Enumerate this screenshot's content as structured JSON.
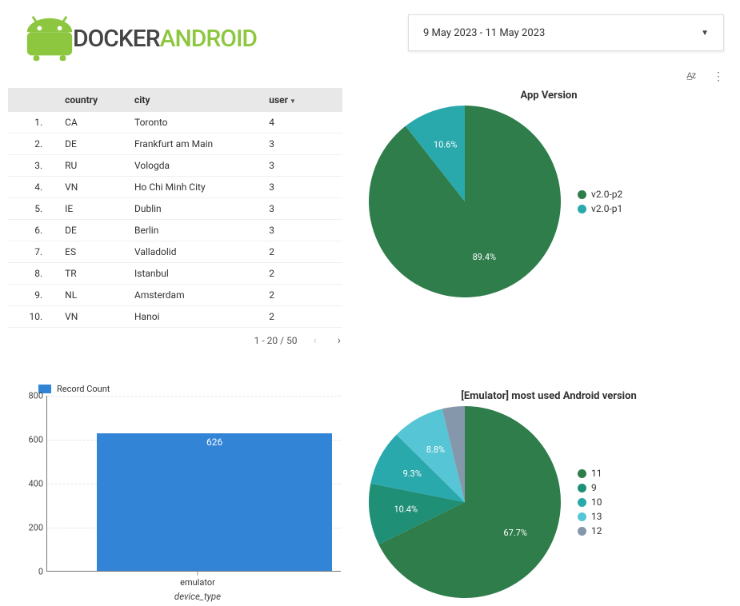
{
  "brand": {
    "name_part1": "DOCKER",
    "name_part2": "ANDROID"
  },
  "date_range": "9 May 2023 - 11 May 2023",
  "toolbar": {
    "sort_icon": "A̲Z",
    "menu_icon": "⋮"
  },
  "table": {
    "headers": {
      "idx": "",
      "country": "country",
      "city": "city",
      "user": "user"
    },
    "rows": [
      {
        "idx": "1.",
        "country": "CA",
        "city": "Toronto",
        "user": "4"
      },
      {
        "idx": "2.",
        "country": "DE",
        "city": "Frankfurt am Main",
        "user": "3"
      },
      {
        "idx": "3.",
        "country": "RU",
        "city": "Vologda",
        "user": "3"
      },
      {
        "idx": "4.",
        "country": "VN",
        "city": "Ho Chi Minh City",
        "user": "3"
      },
      {
        "idx": "5.",
        "country": "IE",
        "city": "Dublin",
        "user": "3"
      },
      {
        "idx": "6.",
        "country": "DE",
        "city": "Berlin",
        "user": "3"
      },
      {
        "idx": "7.",
        "country": "ES",
        "city": "Valladolid",
        "user": "2"
      },
      {
        "idx": "8.",
        "country": "TR",
        "city": "Istanbul",
        "user": "2"
      },
      {
        "idx": "9.",
        "country": "NL",
        "city": "Amsterdam",
        "user": "2"
      },
      {
        "idx": "10.",
        "country": "VN",
        "city": "Hanoi",
        "user": "2"
      }
    ],
    "pagination": {
      "label": "1 - 20 / 50"
    }
  },
  "chart_data": [
    {
      "type": "pie",
      "title": "App Version",
      "series": [
        {
          "name": "v2.0-p2",
          "value": 89.4,
          "color": "#2e7d4b",
          "label": "89.4%"
        },
        {
          "name": "v2.0-p1",
          "value": 10.6,
          "color": "#2aa9ac",
          "label": "10.6%"
        }
      ]
    },
    {
      "type": "bar",
      "legend": "Record Count",
      "xlabel": "device_type",
      "categories": [
        "emulator"
      ],
      "values": [
        626
      ],
      "ylim": [
        0,
        800
      ],
      "yticks": [
        0,
        200,
        400,
        600,
        800
      ]
    },
    {
      "type": "pie",
      "title": "[Emulator] most used Android version",
      "series": [
        {
          "name": "11",
          "value": 67.7,
          "color": "#2e7d4b",
          "label": "67.7%"
        },
        {
          "name": "9",
          "value": 10.4,
          "color": "#1f8f76",
          "label": "10.4%"
        },
        {
          "name": "10",
          "value": 9.3,
          "color": "#2aa9ac",
          "label": "9.3%"
        },
        {
          "name": "13",
          "value": 8.8,
          "color": "#56c5d6",
          "label": "8.8%"
        },
        {
          "name": "12",
          "value": 3.8,
          "color": "#8597aa",
          "label": ""
        }
      ]
    }
  ]
}
